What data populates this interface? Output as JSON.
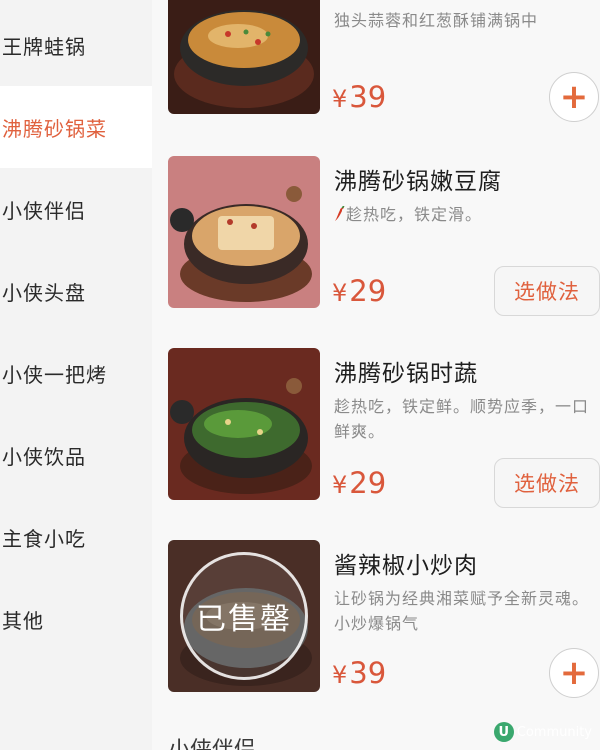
{
  "sidebar": {
    "items": [
      {
        "label": "王牌蛙锅"
      },
      {
        "label": "沸腾砂锅菜"
      },
      {
        "label": "小侠伴侣"
      },
      {
        "label": "小侠头盘"
      },
      {
        "label": "小侠一把烤"
      },
      {
        "label": "小侠饮品"
      },
      {
        "label": "主食小吃"
      },
      {
        "label": "其他"
      }
    ],
    "active_index": 1
  },
  "menu": {
    "items": [
      {
        "desc": "独头蒜蓉和红葱酥铺满锅中",
        "currency": "¥",
        "price": "39",
        "action": "add"
      },
      {
        "name": "沸腾砂锅嫩豆腐",
        "desc_icon": "chili-icon",
        "desc": "趁热吃，铁定滑。",
        "currency": "¥",
        "price": "29",
        "action_label": "选做法"
      },
      {
        "name": "沸腾砂锅时蔬",
        "desc": "趁热吃，铁定鲜。顺势应季，一口鲜爽。",
        "currency": "¥",
        "price": "29",
        "action_label": "选做法"
      },
      {
        "name": "酱辣椒小炒肉",
        "desc": "让砂锅为经典湘菜赋予全新灵魂。小炒爆锅气",
        "currency": "¥",
        "price": "39",
        "action": "add",
        "sold_out_label": "已售罄"
      }
    ],
    "next_section_title": "小侠伴侣",
    "add_symbol": "+"
  },
  "watermark": {
    "badge": "U",
    "text": "Community"
  },
  "colors": {
    "accent": "#e0613e",
    "price": "#d9573b",
    "active_bg": "#ffffff",
    "sidebar_bg": "#f3f3f3"
  }
}
